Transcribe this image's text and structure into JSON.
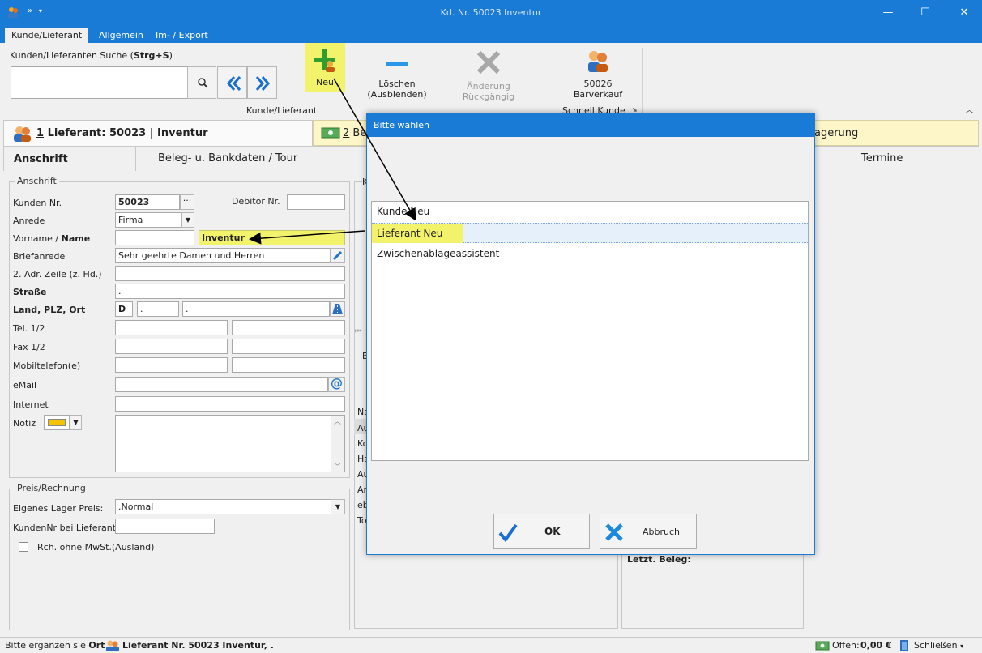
{
  "window": {
    "title": "Kd. Nr. 50023 Inventur",
    "minimize": "—",
    "maximize": "☐",
    "close": "✕"
  },
  "ribbon_tabs": [
    "Kunde/Lieferant",
    "Allgemein",
    "Im- / Export"
  ],
  "search": {
    "label_prefix": "Kunden/Lieferanten Suche (",
    "label_shortcut": "Strg+S",
    "label_suffix": ")",
    "value": ""
  },
  "ribbon": {
    "new_label": "Neu",
    "delete_label_1": "Löschen",
    "delete_label_2": "(Ausblenden)",
    "undo_label": "Änderung Rückgängig",
    "group_label": "Kunde/Lieferant",
    "cash_number": "50026",
    "cash_label": "Barverkauf",
    "quick_group_label": "Schnell Kunde"
  },
  "record_tabs": {
    "tab1_num": "1",
    "tab1_label": "Lieferant: 50023 | Inventur",
    "tab2_num": "2",
    "tab2_label": "Be",
    "tab3_label": "agerung"
  },
  "sub_tabs": [
    "Anschrift",
    "Beleg- u. Bankdaten / Tour",
    "Termine"
  ],
  "anschrift": {
    "group_title": "Anschrift",
    "kunden_nr_label": "Kunden Nr.",
    "kunden_nr": "50023",
    "debitor_label": "Debitor Nr.",
    "debitor": "",
    "anrede_label": "Anrede",
    "anrede": "Firma",
    "vorname_label": "Vorname /",
    "name_label": "Name",
    "vorname": "",
    "name": "Inventur",
    "briefanrede_label": "Briefanrede",
    "briefanrede": "Sehr geehrte Damen und Herren",
    "adr2_label": "2. Adr. Zeile (z. Hd.)",
    "adr2": "",
    "strasse_label": "Straße",
    "strasse": ".",
    "land_label": "Land, PLZ, Ort",
    "land": "D",
    "plz": ".",
    "ort": ".",
    "tel_label": "Tel. 1/2",
    "fax_label": "Fax 1/2",
    "mobil_label": "Mobiltelefon(e)",
    "email_label": "eMail",
    "internet_label": "Internet",
    "notiz_label": "Notiz",
    "notiz_color": "#f5c400"
  },
  "preis": {
    "group_title": "Preis/Rechnung",
    "lager_label": "Eigenes Lager Preis:",
    "lager_value": ".Normal",
    "kundennr_label": "KundenNr bei Lieferant:",
    "kundennr": "",
    "mwst_label": "Rch. ohne MwSt.(Ausland)"
  },
  "middle_panel": {
    "top_letter": "K",
    "second_letter": "B",
    "rows": [
      "Na",
      "Au",
      "Ko",
      "Ha",
      "Au",
      "An",
      "eb",
      "To"
    ]
  },
  "right_panel": {
    "letzt_beleg_label": "Letzt. Beleg:"
  },
  "dialog": {
    "title": "Bitte wählen",
    "items": [
      "Kunde Neu",
      "Lieferant Neu",
      "Zwischenablageassistent"
    ],
    "selected_index": 1,
    "ok_label": "OK",
    "cancel_label": "Abbruch"
  },
  "status": {
    "hint_prefix": "Bitte ergänzen sie",
    "hint_field": "Ort",
    "record": "Lieferant Nr. 50023 Inventur, .",
    "offen_label": "Offen:",
    "offen_value": "0,00 €",
    "close_label": "Schließen"
  },
  "colors": {
    "titlebar": "#1a7bd6",
    "highlight": "#f3f36b",
    "selection": "#e5f0fb"
  }
}
